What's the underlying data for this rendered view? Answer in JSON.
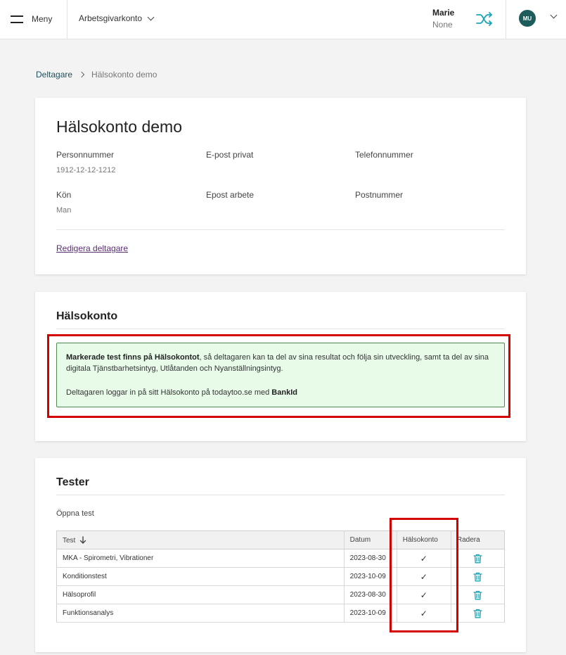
{
  "header": {
    "menu_label": "Meny",
    "employer_label": "Arbetsgivarkonto",
    "user_name": "Marie",
    "user_sub": "None",
    "avatar_initials": "MU",
    "accent_color": "#1aa6b7",
    "avatar_color": "#1d5c5a"
  },
  "breadcrumb": {
    "parent": "Deltagare",
    "current": "Hälsokonto demo"
  },
  "profile": {
    "title": "Hälsokonto demo",
    "fields": [
      {
        "label": "Personnummer",
        "value": "1912-12-12-1212"
      },
      {
        "label": "E-post privat",
        "value": ""
      },
      {
        "label": "Telefonnummer",
        "value": ""
      },
      {
        "label": "Kön",
        "value": "Man"
      },
      {
        "label": "Epost arbete",
        "value": ""
      },
      {
        "label": "Postnummer",
        "value": ""
      }
    ],
    "edit_link": "Redigera deltagare"
  },
  "health_account": {
    "title": "Hälsokonto",
    "info_bold": "Markerade test finns på Hälsokontot",
    "info_rest": ", så deltagaren kan ta del av sina resultat och följa sin utveckling, samt ta del av sina digitala Tjänstbarhetsintyg, Utlåtanden och Nyanställningsintyg.",
    "login_prefix": "Deltagaren loggar in på sitt Hälsokonto på todaytoo.se med ",
    "login_bold": "BankId"
  },
  "tests": {
    "title": "Tester",
    "subtitle": "Öppna test",
    "columns": {
      "test": "Test",
      "date": "Datum",
      "health": "Hälsokonto",
      "delete": "Radera"
    },
    "rows": [
      {
        "name": "MKA - Spirometri, Vibrationer",
        "date": "2023-08-30",
        "check": "✓"
      },
      {
        "name": "Konditionstest",
        "date": "2023-10-09",
        "check": "✓"
      },
      {
        "name": "Hälsoprofil",
        "date": "2023-08-30",
        "check": "✓"
      },
      {
        "name": "Funktionsanalys",
        "date": "2023-10-09",
        "check": "✓"
      }
    ]
  }
}
